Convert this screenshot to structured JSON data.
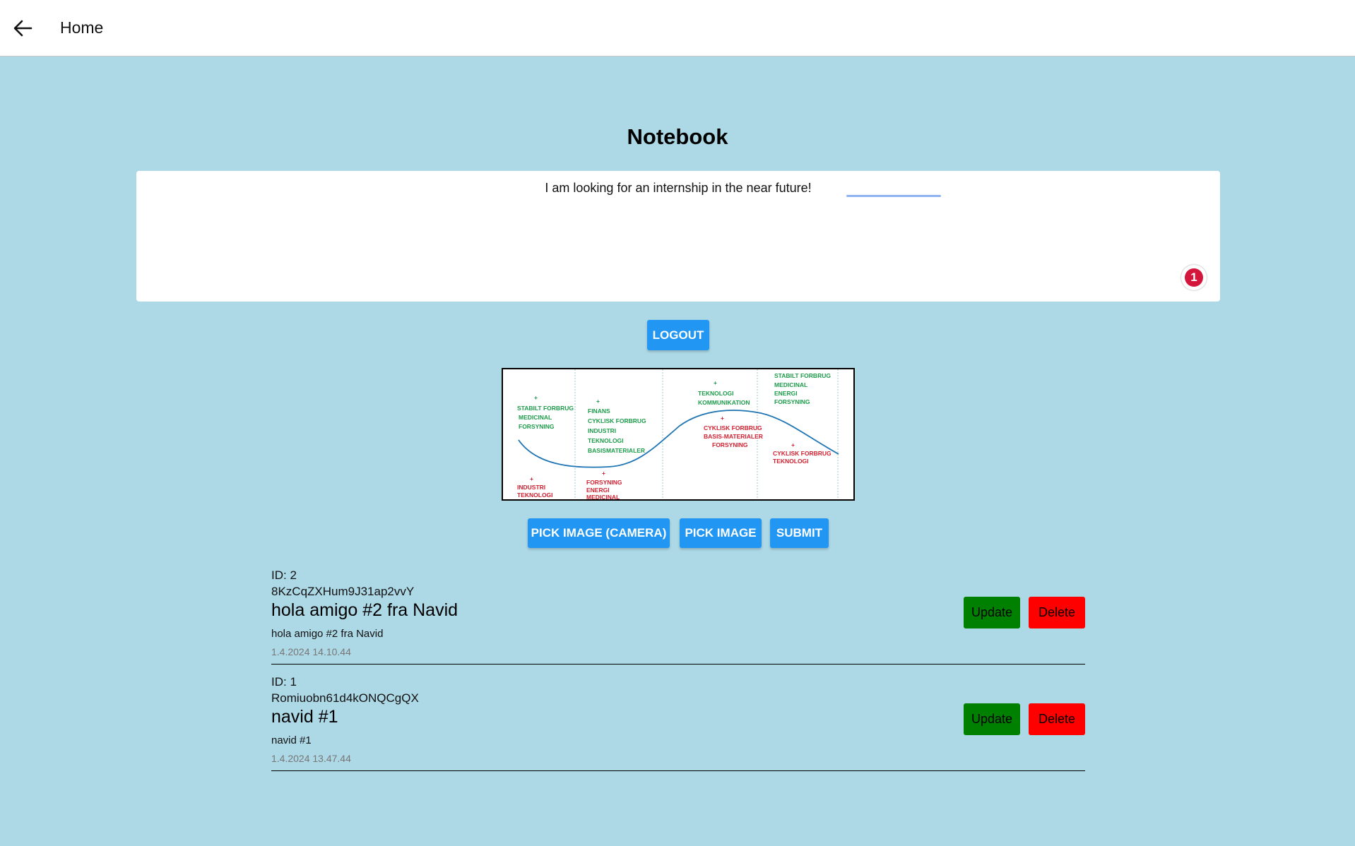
{
  "topbar": {
    "title": "Home",
    "back_icon": "arrow-left-icon"
  },
  "page": {
    "title": "Notebook"
  },
  "note_input": {
    "value": "I am looking for an internship in the near future!",
    "issue_count": "1"
  },
  "buttons": {
    "logout": "LOGOUT",
    "pick_image_camera": "PICK IMAGE (CAMERA)",
    "pick_image": "PICK IMAGE",
    "submit": "SUBMIT"
  },
  "image_preview": {
    "labels_green": [
      "STABILT FORBRUG",
      "MEDICINAL",
      "FORSYNING",
      "FINANS",
      "CYKLISK FORBRUG",
      "INDUSTRI",
      "TEKNOLOGI",
      "BASISMATERIALER",
      "TEKNOLOGI",
      "KOMMUNIKATION",
      "STABILT FORBRUG",
      "MEDICINAL",
      "ENERGI",
      "FORSYNING"
    ],
    "labels_red": [
      "INDUSTRI",
      "TEKNOLOGI",
      "FORSYNING",
      "ENERGI",
      "MEDICINAL",
      "CYKLISK FORBRUG",
      "BASIS-MATERIALER",
      "FORSYNING",
      "CYKLISK FORBRUG",
      "TEKNOLOGI"
    ]
  },
  "notes": [
    {
      "id_label": "ID: 2",
      "key": "8KzCqZXHum9J31ap2vvY",
      "title": "hola amigo #2 fra Navid",
      "body": "hola amigo #2 fra Navid",
      "date": "1.4.2024 14.10.44",
      "update_label": "Update",
      "delete_label": "Delete"
    },
    {
      "id_label": "ID: 1",
      "key": "Romiuobn61d4kONQCgQX",
      "title": "navid #1",
      "body": "navid #1",
      "date": "1.4.2024 13.47.44",
      "update_label": "Update",
      "delete_label": "Delete"
    }
  ],
  "colors": {
    "background": "#ADD8E6",
    "primary_button": "#2196F3",
    "update_button": "#008000",
    "delete_button": "#FF0000",
    "badge": "#D4163C"
  }
}
